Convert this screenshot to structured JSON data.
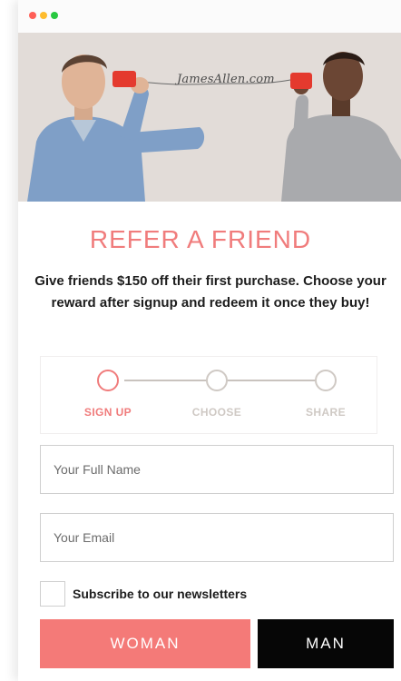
{
  "window": {
    "controls": [
      "close",
      "minimize",
      "zoom"
    ]
  },
  "hero": {
    "brand": "JamesAllen.com",
    "icon": "tin-can-telephone-icon"
  },
  "title": "REFER A FRIEND",
  "subtitle": "Give friends $150 off their first purchase. Choose your reward after signup and redeem it once they buy!",
  "steps": [
    {
      "label": "SIGN UP",
      "active": true
    },
    {
      "label": "CHOOSE",
      "active": false
    },
    {
      "label": "SHARE",
      "active": false
    }
  ],
  "form": {
    "name_placeholder": "Your Full Name",
    "email_placeholder": "Your Email",
    "subscribe_label": "Subscribe to our newsletters"
  },
  "buttons": {
    "woman_label": "WOMAN",
    "man_label": "MAN"
  },
  "colors": {
    "accent": "#f07c7c",
    "woman_button": "#f47a78",
    "man_button": "#060606"
  }
}
